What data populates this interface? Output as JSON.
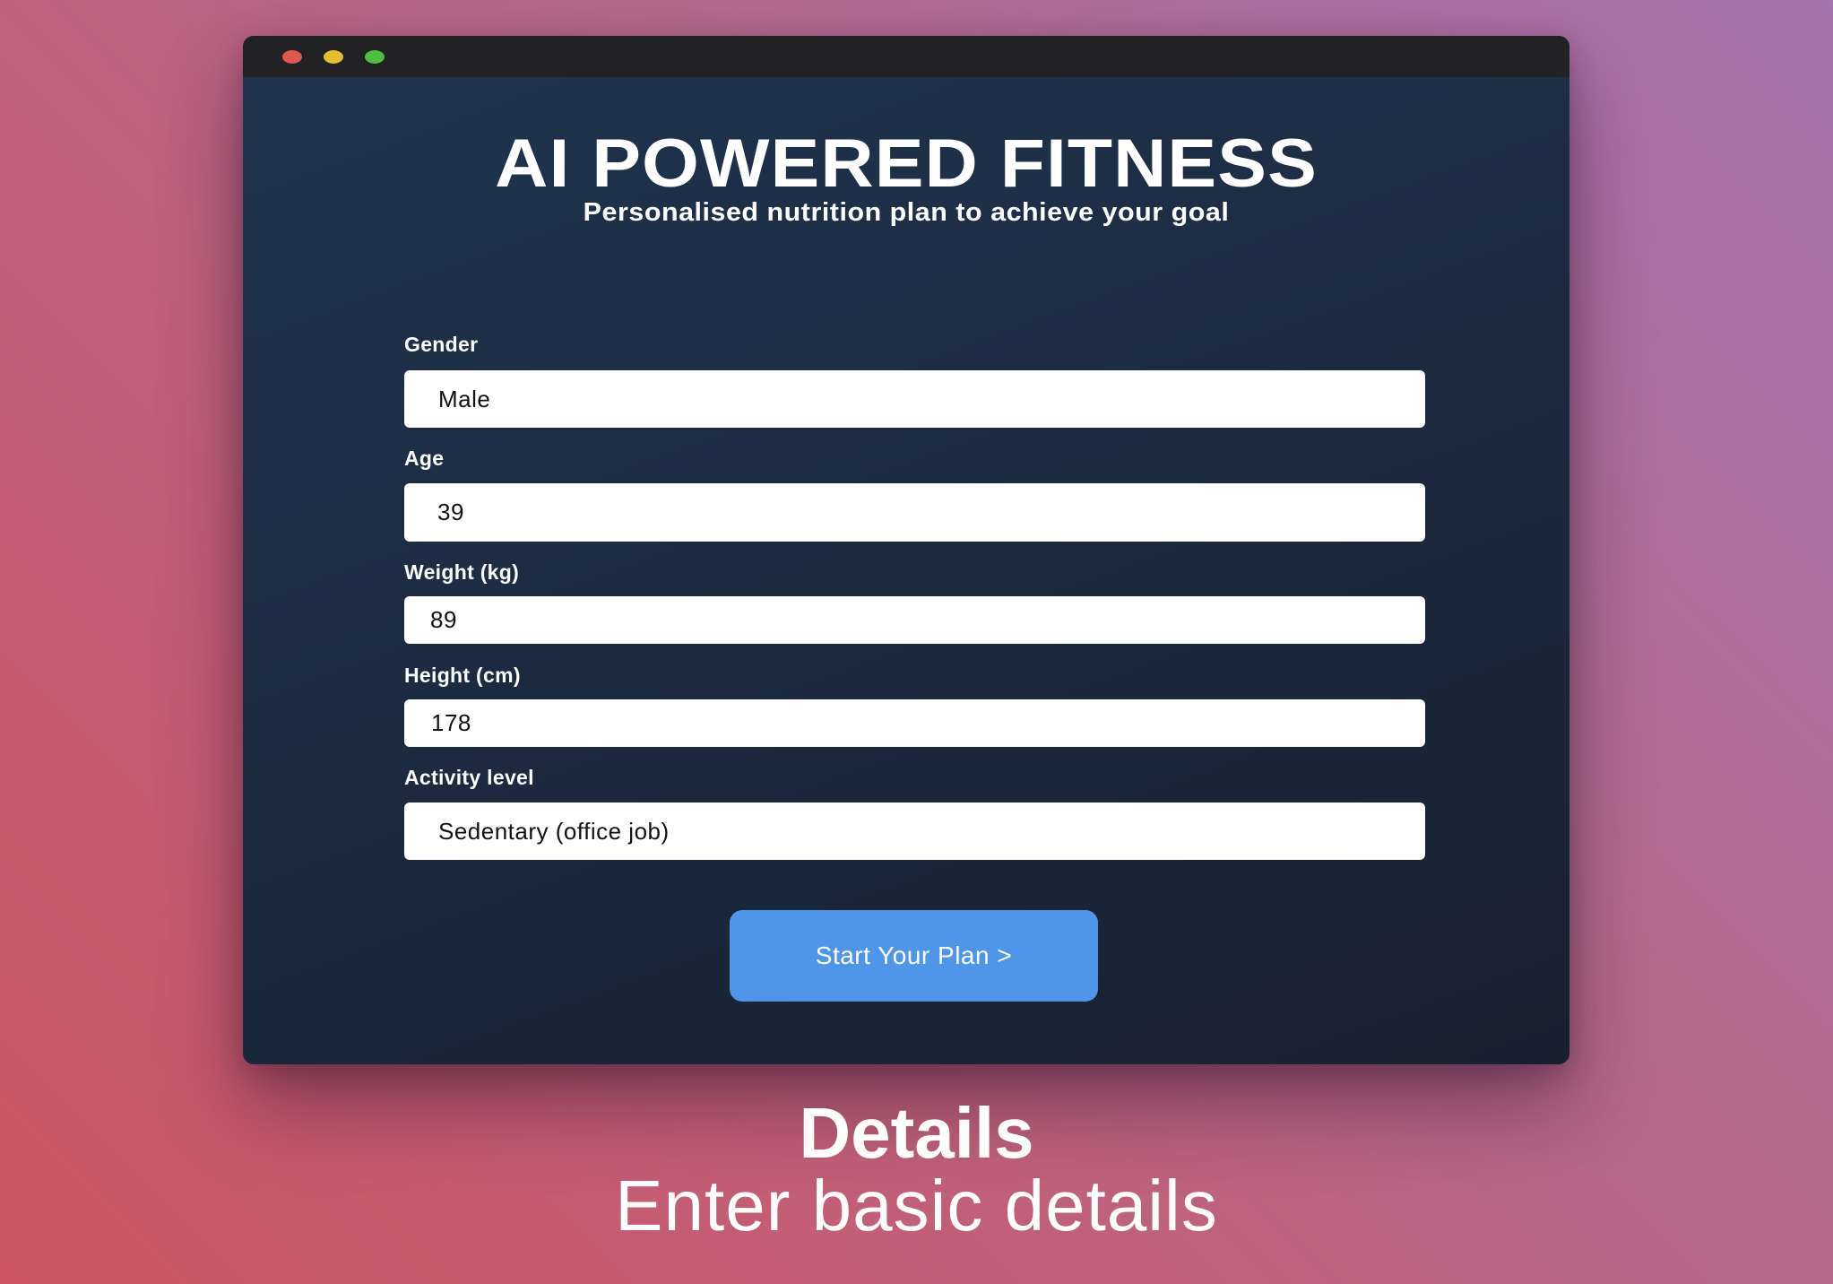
{
  "app": {
    "title": "AI POWERED FITNESS",
    "subtitle": "Personalised nutrition plan to achieve your goal"
  },
  "form": {
    "fields": [
      {
        "label": "Gender",
        "value": "Male"
      },
      {
        "label": "Age",
        "value": "39"
      },
      {
        "label": "Weight (kg)",
        "value": "89"
      },
      {
        "label": "Height (cm)",
        "value": "178"
      },
      {
        "label": "Activity level",
        "value": "Sedentary (office job)"
      }
    ],
    "submit_label": "Start Your Plan >"
  },
  "caption": {
    "title": "Details",
    "subtitle": "Enter basic details"
  },
  "colors": {
    "window_bg": "#1c2a40",
    "button": "#4f96ea",
    "traffic_red": "#e0574f",
    "traffic_yellow": "#e2c02e",
    "traffic_green": "#4fbf43"
  }
}
